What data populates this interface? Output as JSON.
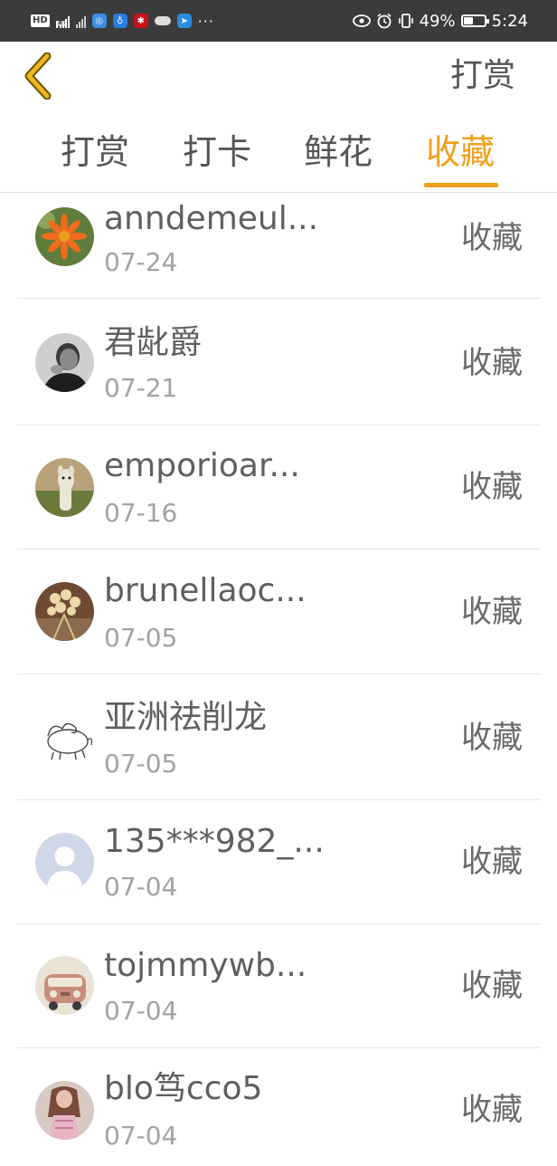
{
  "status_bar": {
    "hd_label": "HD",
    "network_label": "4G",
    "more_dots": "···",
    "battery_percent": "49%",
    "battery_level": 0.49,
    "time": "5:24"
  },
  "header": {
    "title": "打赏"
  },
  "tabs": [
    {
      "label": "打赏",
      "active": false
    },
    {
      "label": "打卡",
      "active": false
    },
    {
      "label": "鲜花",
      "active": false
    },
    {
      "label": "收藏",
      "active": true
    }
  ],
  "list": [
    {
      "name": "anndemeul...",
      "date": "07-24",
      "action": "收藏"
    },
    {
      "name": "君龀爵",
      "date": "07-21",
      "action": "收藏"
    },
    {
      "name": "emporioar...",
      "date": "07-16",
      "action": "收藏"
    },
    {
      "name": "brunellaoc...",
      "date": "07-05",
      "action": "收藏"
    },
    {
      "name": "亚洲祛削龙",
      "date": "07-05",
      "action": "收藏"
    },
    {
      "name": "135***982_...",
      "date": "07-04",
      "action": "收藏"
    },
    {
      "name": "tojmmywb...",
      "date": "07-04",
      "action": "收藏"
    },
    {
      "name": "blo笃cco5",
      "date": "07-04",
      "action": "收藏"
    }
  ],
  "colors": {
    "accent": "#f0a01c",
    "back_arrow": "#f0b81e",
    "status_bar_bg": "#3b3b3b"
  }
}
